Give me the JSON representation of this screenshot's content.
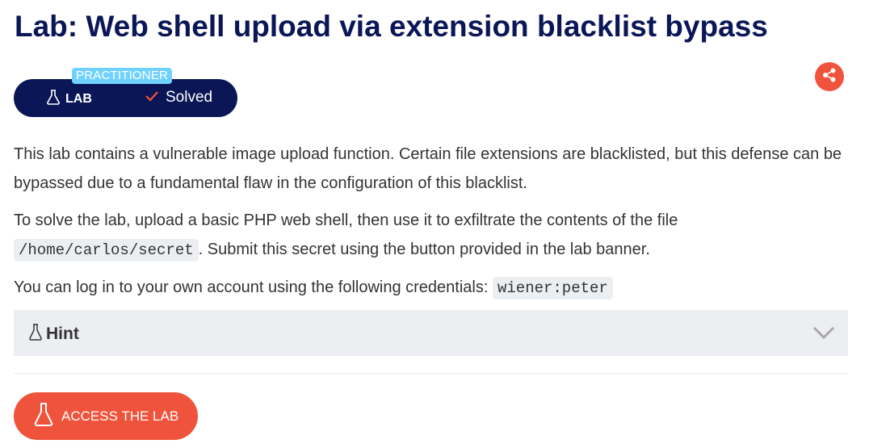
{
  "header": {
    "title": "Lab: Web shell upload via extension blacklist bypass"
  },
  "badge": {
    "level": "PRACTITIONER",
    "lab_label": "LAB",
    "status": "Solved"
  },
  "share": {
    "icon": "share-icon"
  },
  "description": {
    "p1": "This lab contains a vulnerable image upload function. Certain file extensions are blacklisted, but this defense can be bypassed due to a fundamental flaw in the configuration of this blacklist.",
    "p2_before": "To solve the lab, upload a basic PHP web shell, then use it to exfiltrate the contents of the file",
    "p2_code": "/home/carlos/secret",
    "p2_after": ". Submit this secret using the button provided in the lab banner.",
    "p3_before": "You can log in to your own account using the following credentials:",
    "p3_code": "wiener:peter"
  },
  "hint": {
    "label": "Hint"
  },
  "access_button": {
    "label": "ACCESS THE LAB"
  },
  "colors": {
    "navy": "#0b1657",
    "accent": "#f0533b",
    "level": "#70d2ff"
  }
}
